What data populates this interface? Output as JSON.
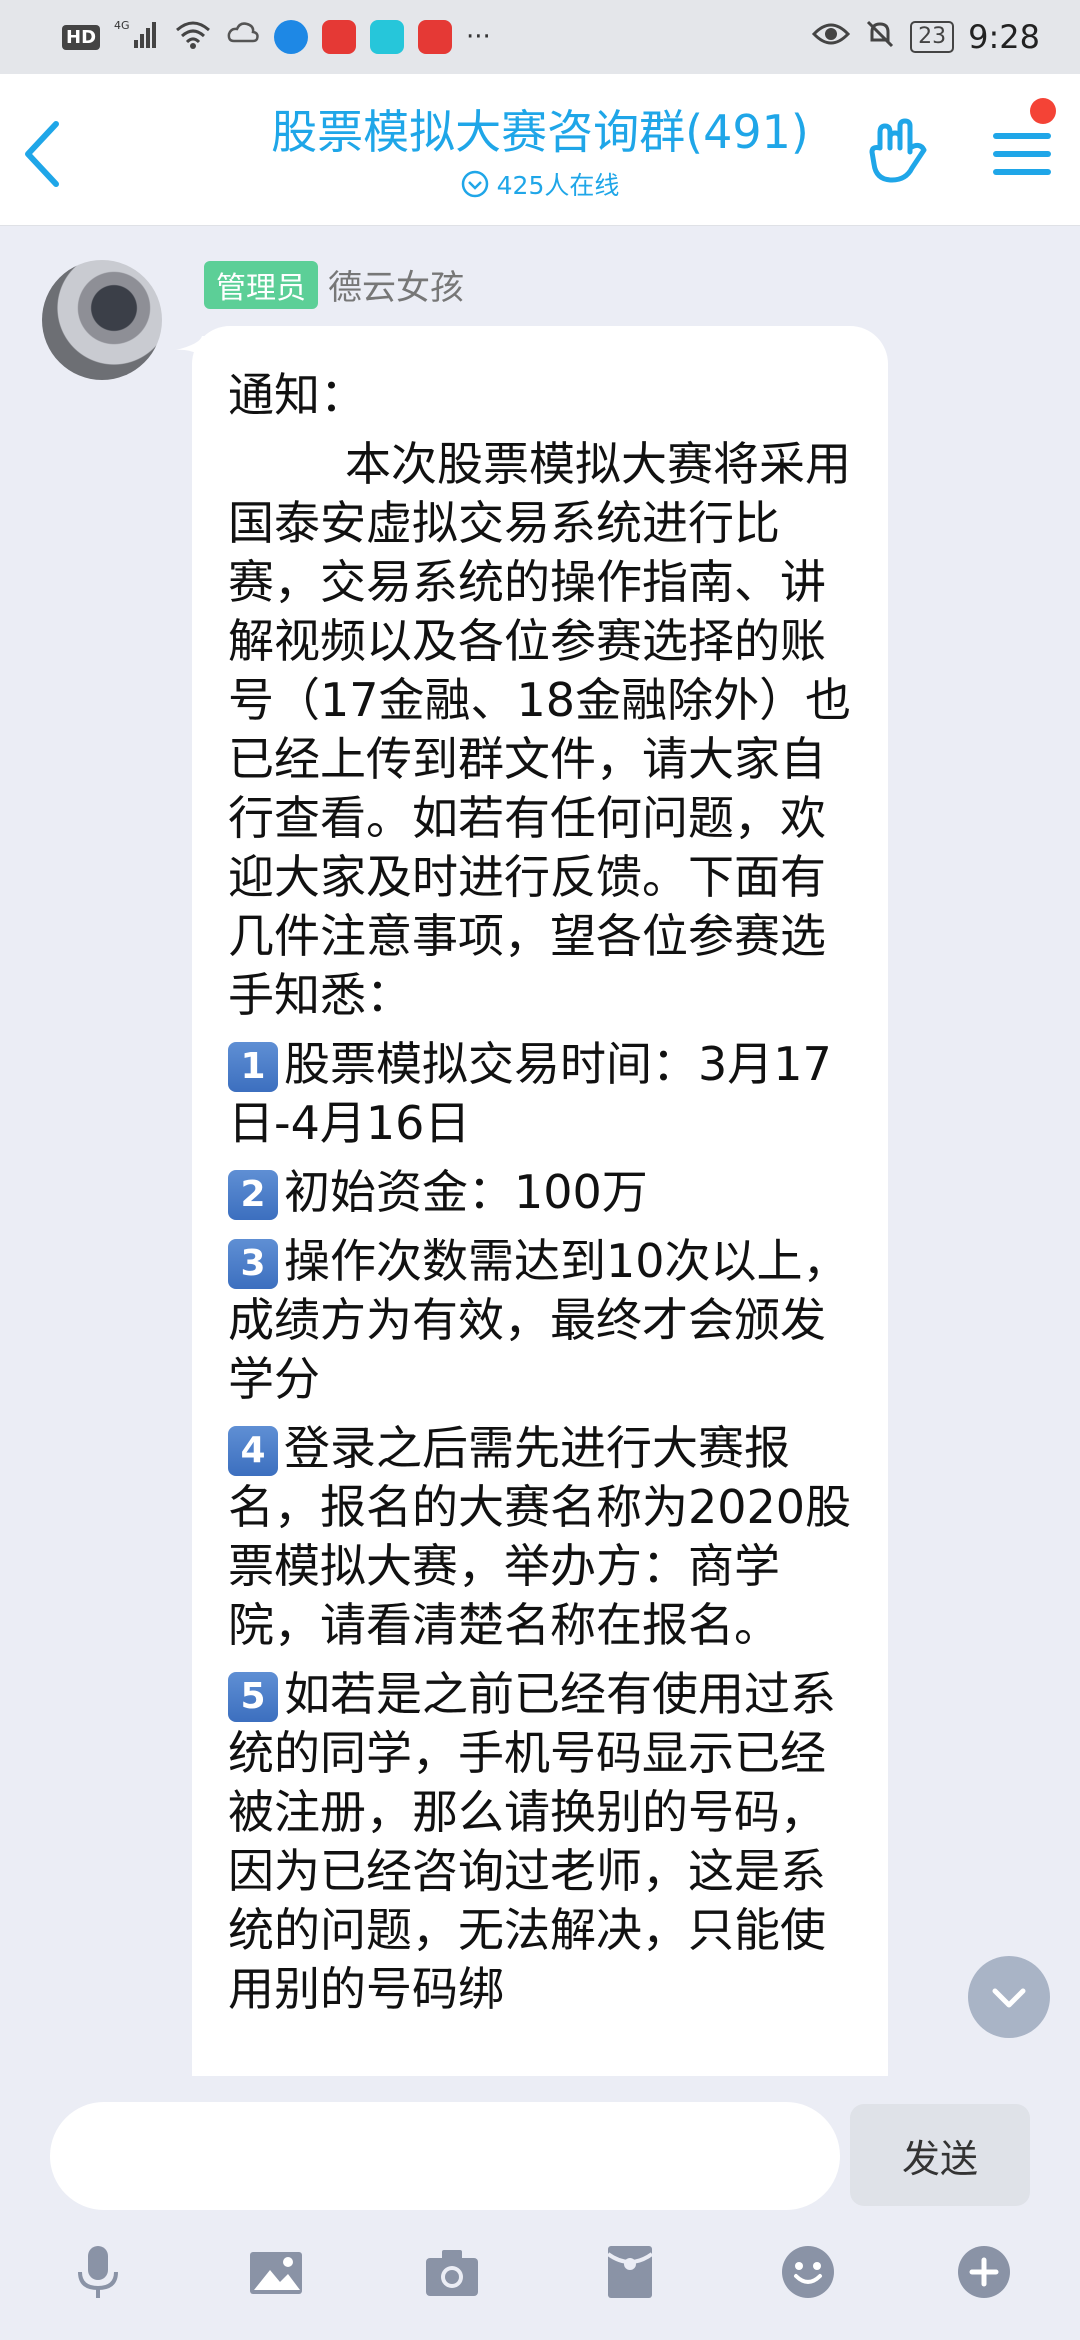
{
  "status_bar": {
    "hd_label": "HD",
    "network_label": "4G",
    "battery_level": "23",
    "time": "9:28",
    "more_dots": "···"
  },
  "header": {
    "title": "股票模拟大赛咨询群(491)",
    "online_status": "425人在线"
  },
  "message": {
    "badge": "管理员",
    "sender": "德云女孩",
    "heading": "通知：",
    "intro": "        本次股票模拟大赛将采用国泰安虚拟交易系统进行比赛，交易系统的操作指南、讲解视频以及各位参赛选择的账号（17金融、18金融除外）也已经上传到群文件，请大家自行查看。如若有任何问题，欢迎大家及时进行反馈。下面有几件注意事项，望各位参赛选手知悉：",
    "items": [
      {
        "num": "1",
        "text": "股票模拟交易时间：3月17日-4月16日"
      },
      {
        "num": "2",
        "text": "初始资金：100万"
      },
      {
        "num": "3",
        "text": "操作次数需达到10次以上，成绩方为有效，最终才会颁发学分"
      },
      {
        "num": "4",
        "text": "登录之后需先进行大赛报名，报名的大赛名称为2020股票模拟大赛，举办方：商学院，请看清楚名称在报名。"
      },
      {
        "num": "5",
        "text": "如若是之前已经有使用过系统的同学，手机号码显示已经被注册，那么请换别的号码，因为已经咨询过老师，这是系统的问题，无法解决，只能使用别的号码绑"
      }
    ]
  },
  "input": {
    "placeholder": "",
    "send_label": "发送"
  },
  "colors": {
    "accent": "#1fa6e8",
    "admin_badge": "#5ccf97",
    "background": "#ebedf5",
    "notification_dot": "#f44336"
  },
  "toolbar_icons": [
    "microphone-icon",
    "image-icon",
    "camera-icon",
    "red-packet-icon",
    "emoji-icon",
    "plus-icon"
  ]
}
